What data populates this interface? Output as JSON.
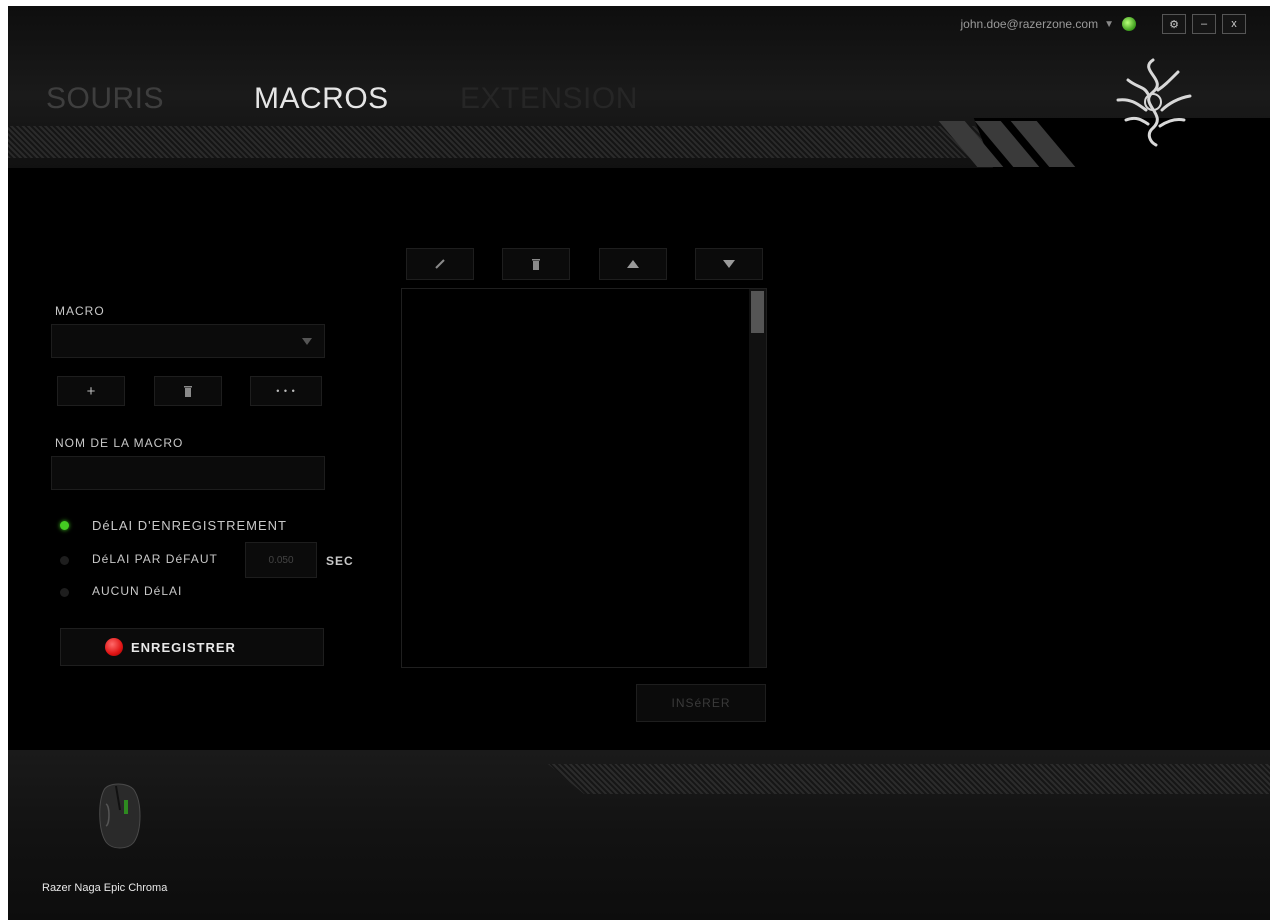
{
  "topbar": {
    "email": "john.doe@razerzone.com",
    "account_caret": "▼",
    "settings_glyph": "⚙",
    "minimize_glyph": "–",
    "close_glyph": "x"
  },
  "tabs": [
    {
      "label": "SOURIS",
      "active": false
    },
    {
      "label": "MACROS",
      "active": true
    },
    {
      "label": "EXTENSION",
      "active": false
    }
  ],
  "macro": {
    "label": "MACRO",
    "select_value": "",
    "add_glyph": "+",
    "more_glyph": "• • •"
  },
  "macro_name": {
    "label": "NOM DE LA MACRO",
    "value": ""
  },
  "delay_options": [
    {
      "label": "DéLAI D'ENREGISTREMENT",
      "selected": true
    },
    {
      "label": "DéLAI PAR DéFAUT",
      "selected": false
    },
    {
      "label": "AUCUN DéLAI",
      "selected": false
    }
  ],
  "default_delay": {
    "value": "0.050",
    "unit": "SEC"
  },
  "record_button": "ENREGISTRER",
  "insert_button": "INSéRER",
  "device": {
    "name": "Razer Naga Epic Chroma"
  },
  "colors": {
    "active_radio": "#44cc22",
    "record": "#e01414"
  }
}
